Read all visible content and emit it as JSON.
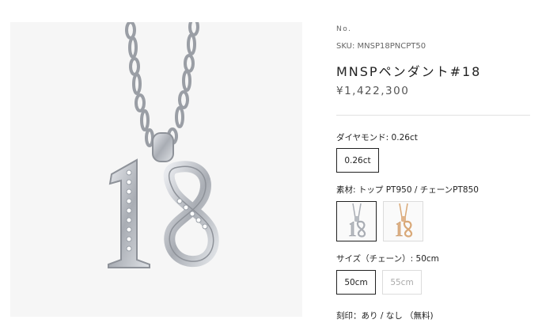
{
  "product": {
    "no_label": "No.",
    "sku": "SKU: MNSP18PNCPT50",
    "title": "MNSPペンダント#18",
    "price": "¥1,422,300"
  },
  "options": {
    "diamond": {
      "label": "ダイヤモンド: 0.26ct",
      "choices": [
        {
          "label": "0.26ct",
          "selected": true
        }
      ]
    },
    "material": {
      "label": "素材: トップ PT950 / チェーンPT850",
      "swatches": [
        {
          "name": "platinum",
          "selected": true,
          "color": "#b8bcc2"
        },
        {
          "name": "gold",
          "selected": false,
          "color": "#d9a877"
        }
      ]
    },
    "size": {
      "label": "サイズ（チェーン）: 50cm",
      "choices": [
        {
          "label": "50cm",
          "selected": true
        },
        {
          "label": "55cm",
          "selected": false
        }
      ]
    },
    "engraving": {
      "label": "刻印：あり / なし （無料)"
    }
  },
  "image": {
    "subject": "pendant-18-icon"
  }
}
